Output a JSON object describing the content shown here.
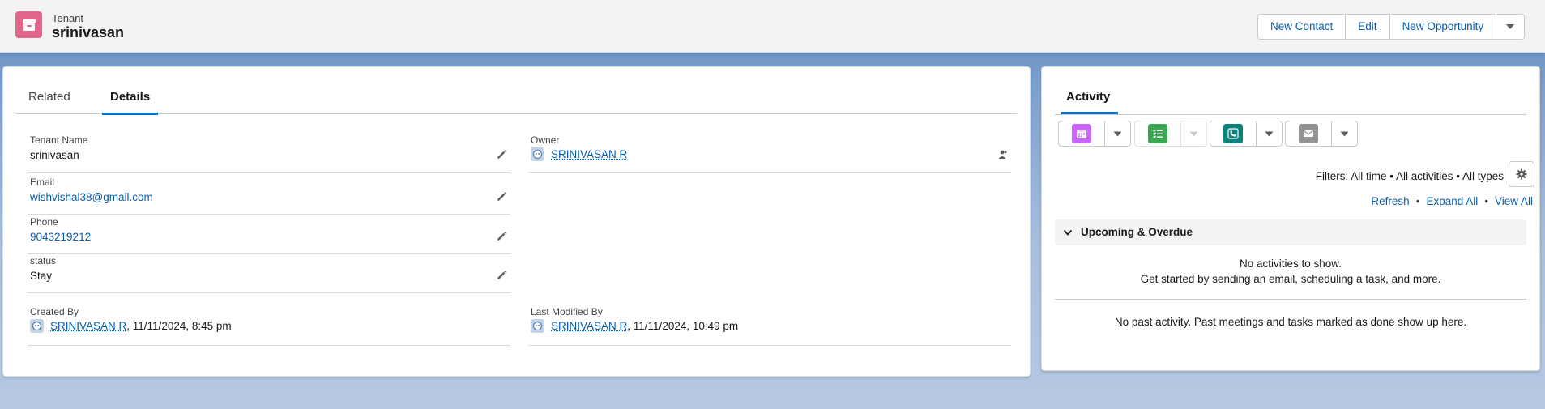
{
  "header": {
    "object_type": "Tenant",
    "record_name": "srinivasan",
    "icon": "archive-box-icon",
    "icon_color": "#e2668b",
    "buttons": [
      "New Contact",
      "Edit",
      "New Opportunity"
    ],
    "more_icon": "chevron-down-icon"
  },
  "tabs": {
    "related": "Related",
    "details": "Details",
    "active": "Details"
  },
  "fields": {
    "tenant_name": {
      "label": "Tenant Name",
      "value": "srinivasan"
    },
    "email": {
      "label": "Email",
      "value": "wishvishal38@gmail.com"
    },
    "phone": {
      "label": "Phone",
      "value": "9043219212"
    },
    "status": {
      "label": "status",
      "value": "Stay"
    },
    "owner": {
      "label": "Owner",
      "value": "SRINIVASAN R"
    },
    "created_by": {
      "label": "Created By",
      "user": "SRINIVASAN R",
      "date": ", 11/11/2024, 8:45 pm"
    },
    "last_modified_by": {
      "label": "Last Modified By",
      "user": "SRINIVASAN R",
      "date": ", 11/11/2024, 10:49 pm"
    }
  },
  "activity": {
    "tab": "Activity",
    "action_buttons": [
      {
        "icon": "calendar-icon",
        "color": "#cb65ff"
      },
      {
        "icon": "task-list-icon",
        "color": "#3ba755"
      },
      {
        "icon": "phone-icon",
        "color": "#0b827c"
      },
      {
        "icon": "email-icon",
        "color": "#939393"
      }
    ],
    "filters": "Filters: All time • All activities • All types",
    "links": {
      "refresh": "Refresh",
      "expand_all": "Expand All",
      "view_all": "View All",
      "separator": "•"
    },
    "upcoming_title": "Upcoming & Overdue",
    "no_activities": "No activities to show.",
    "get_started": "Get started by sending an email, scheduling a task, and more.",
    "no_past": "No past activity. Past meetings and tasks marked as done show up here."
  },
  "colors": {
    "brand_blue": "#0176d3",
    "link": "#0b5cab"
  }
}
